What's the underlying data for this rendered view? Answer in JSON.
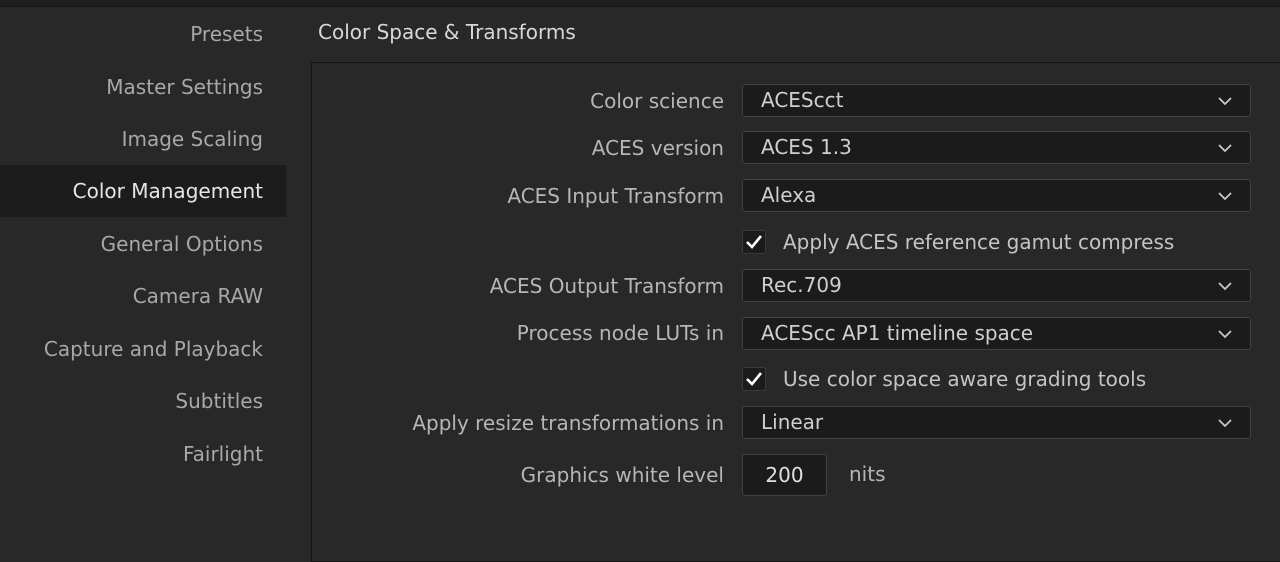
{
  "sidebar": {
    "items": [
      {
        "label": "Presets",
        "active": false
      },
      {
        "label": "Master Settings",
        "active": false
      },
      {
        "label": "Image Scaling",
        "active": false
      },
      {
        "label": "Color Management",
        "active": true
      },
      {
        "label": "General Options",
        "active": false
      },
      {
        "label": "Camera RAW",
        "active": false
      },
      {
        "label": "Capture and Playback",
        "active": false
      },
      {
        "label": "Subtitles",
        "active": false
      },
      {
        "label": "Fairlight",
        "active": false
      }
    ]
  },
  "section": {
    "title": "Color Space & Transforms"
  },
  "fields": {
    "color_science": {
      "label": "Color science",
      "value": "ACEScct"
    },
    "aces_version": {
      "label": "ACES version",
      "value": "ACES 1.3"
    },
    "aces_input_transform": {
      "label": "ACES Input Transform",
      "value": "Alexa"
    },
    "gamut_compress": {
      "label": "Apply ACES reference gamut compress",
      "checked": true
    },
    "aces_output_transform": {
      "label": "ACES Output Transform",
      "value": "Rec.709"
    },
    "process_node_luts": {
      "label": "Process node LUTs in",
      "value": "ACEScc AP1 timeline space"
    },
    "color_space_aware": {
      "label": "Use color space aware grading tools",
      "checked": true
    },
    "resize_transformations": {
      "label": "Apply resize transformations in",
      "value": "Linear"
    },
    "graphics_white_level": {
      "label": "Graphics white level",
      "value": "200",
      "unit": "nits"
    }
  },
  "icons": {
    "dropdown": "chevron-down-icon",
    "check": "checkmark-icon"
  },
  "colors": {
    "background": "#282828",
    "active_item_bg": "#1c1c1c",
    "field_bg": "#1b1b1b",
    "field_border": "#414141"
  }
}
